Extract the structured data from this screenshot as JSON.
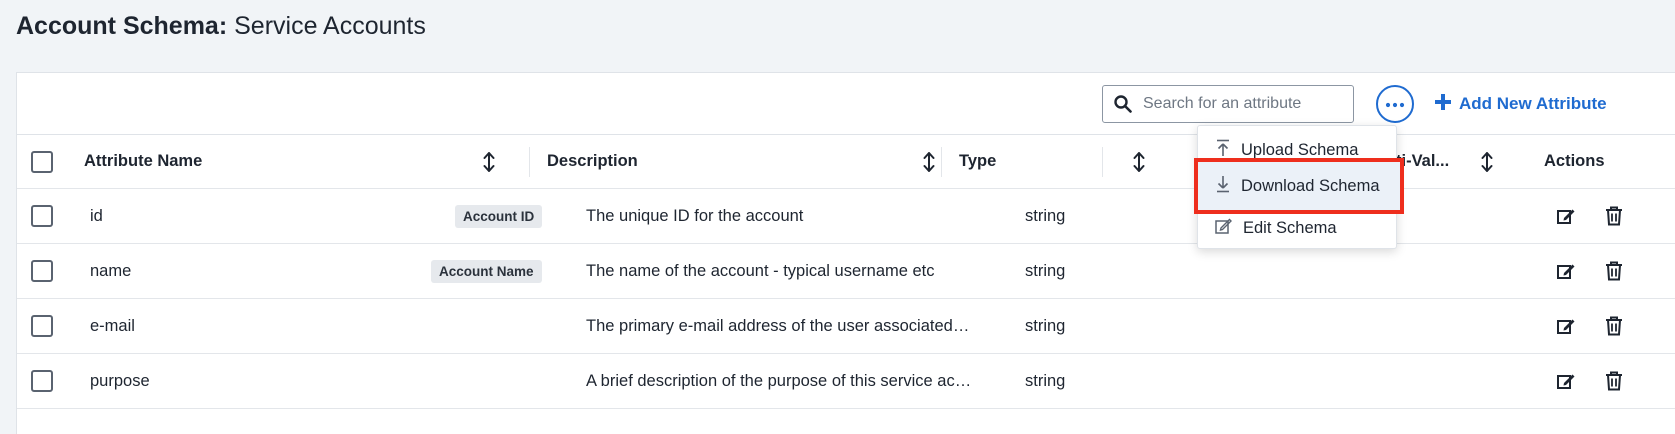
{
  "page": {
    "title_bold": "Account Schema:",
    "title_rest": " Service Accounts"
  },
  "toolbar": {
    "search_placeholder": "Search for an attribute",
    "add_label": "Add New Attribute",
    "more_icon": "ellipsis-icon",
    "accent_color": "#1f6bd0"
  },
  "table": {
    "headers": {
      "attribute_name": "Attribute Name",
      "description": "Description",
      "type": "Type",
      "multi_valued": "ti-Val...",
      "actions": "Actions"
    },
    "rows": [
      {
        "name": "id",
        "tag": "Account ID",
        "description": "The unique ID for the account",
        "type": "string"
      },
      {
        "name": "name",
        "tag": "Account Name",
        "description": "The name of the account - typical username etc",
        "type": "string"
      },
      {
        "name": "e-mail",
        "tag": "",
        "description": "The primary e-mail address of the user associated with this service account",
        "type": "string"
      },
      {
        "name": "purpose",
        "tag": "",
        "description": "A brief description of the purpose of this service account",
        "type": "string"
      }
    ]
  },
  "dropdown": {
    "items": [
      {
        "label": "Upload Schema",
        "icon": "upload-icon"
      },
      {
        "label": "Download Schema",
        "icon": "download-icon",
        "highlighted": true
      },
      {
        "label": "Edit Schema",
        "icon": "edit-icon"
      }
    ],
    "highlight_color": "#ee2e1d"
  }
}
